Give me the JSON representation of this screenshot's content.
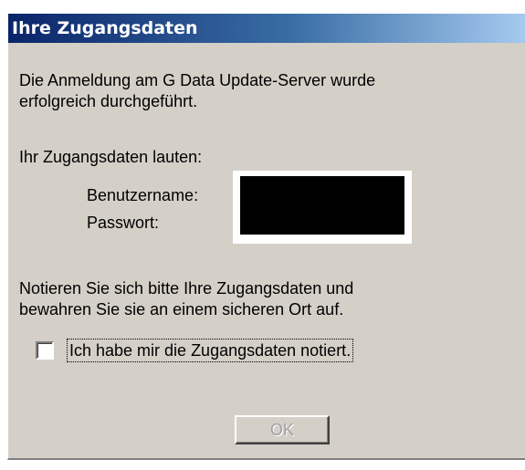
{
  "dialog": {
    "title": "Ihre Zugangsdaten",
    "success_line1": "Die Anmeldung am G Data Update-Server wurde",
    "success_line2": "erfolgreich durchgeführt.",
    "credentials_intro": "Ihr Zugangsdaten lauten:",
    "username_label": "Benutzername:",
    "password_label": "Passwort:",
    "note_line1": "Notieren Sie sich bitte Ihre Zugangsdaten und",
    "note_line2": "bewahren Sie sie an einem sicheren Ort auf.",
    "checkbox_label": "Ich habe mir die Zugangsdaten notiert.",
    "checkbox_checked": false,
    "ok_label": "OK",
    "ok_enabled": false
  },
  "colors": {
    "title_gradient_start": "#0a246a",
    "title_gradient_end": "#a6caf0",
    "dialog_background": "#d4d0c8",
    "disabled_text": "#a0a0a0"
  }
}
